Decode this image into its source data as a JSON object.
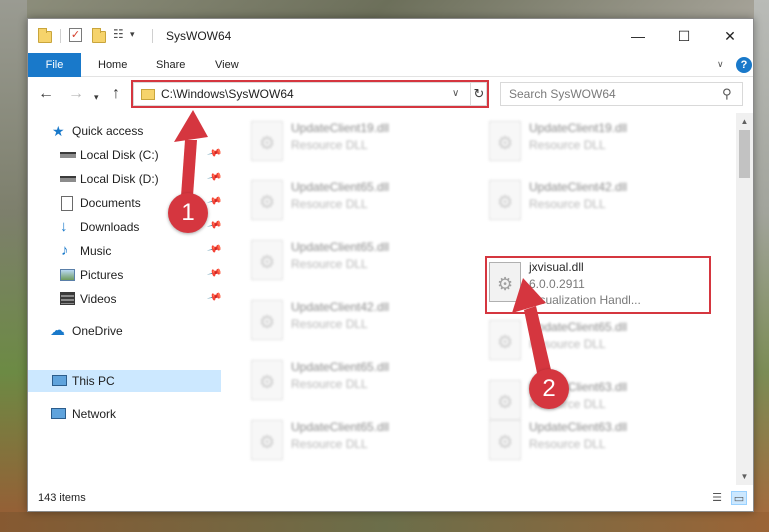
{
  "window": {
    "title": "SysWOW64",
    "minimize_glyph": "—",
    "maximize_glyph": "☐",
    "close_glyph": "✕"
  },
  "ribbon": {
    "tabs": [
      {
        "label": "File",
        "active": true
      },
      {
        "label": "Home"
      },
      {
        "label": "Share"
      },
      {
        "label": "View"
      }
    ],
    "help_glyph": "?",
    "accent_color": "#1979ca"
  },
  "address": {
    "path": "C:\\Windows\\SysWOW64",
    "search_placeholder": "Search SysWOW64"
  },
  "nav": {
    "items": [
      {
        "label": "Quick access",
        "icon": "star-icon",
        "pinned": false
      },
      {
        "label": "Local Disk (C:)",
        "icon": "drive-icon",
        "pinned": true
      },
      {
        "label": "Local Disk (D:)",
        "icon": "drive-icon",
        "pinned": true
      },
      {
        "label": "Documents",
        "icon": "documents-icon",
        "pinned": true
      },
      {
        "label": "Downloads",
        "icon": "downloads-icon",
        "pinned": true
      },
      {
        "label": "Music",
        "icon": "music-icon",
        "pinned": true
      },
      {
        "label": "Pictures",
        "icon": "pictures-icon",
        "pinned": true
      },
      {
        "label": "Videos",
        "icon": "videos-icon",
        "pinned": true
      },
      {
        "label": "OneDrive",
        "icon": "onedrive-icon",
        "pinned": false
      },
      {
        "label": "This PC",
        "icon": "computer-icon",
        "pinned": false,
        "selected": true
      },
      {
        "label": "Network",
        "icon": "network-icon",
        "pinned": false
      }
    ]
  },
  "files": {
    "left_column": [
      {
        "name": "UpdateClient19.dll",
        "desc": "Resource DLL"
      },
      {
        "name": "UpdateClient65.dll",
        "desc": "Resource DLL"
      },
      {
        "name": "UpdateClient65.dll",
        "desc": "Resource DLL"
      },
      {
        "name": "UpdateClient42.dll",
        "desc": "Resource DLL"
      },
      {
        "name": "UpdateClient65.dll",
        "desc": "Resource DLL"
      },
      {
        "name": "UpdateClient65.dll",
        "desc": "Resource DLL"
      }
    ],
    "right_column": [
      {
        "name": "UpdateClient19.dll",
        "desc": "Resource DLL"
      },
      {
        "name": "UpdateClient42.dll",
        "desc": "Resource DLL"
      },
      {
        "name": "jxvisual.dll",
        "desc": "6.0.0.2911",
        "desc2": "Visualization Handl...",
        "highlighted": true
      },
      {
        "name": "UpdateClient65.dll",
        "desc": "Resource DLL"
      },
      {
        "name": "UpdateClient63.dll",
        "desc": "Resource DLL"
      },
      {
        "name": "UpdateClient63.dll",
        "desc": "Resource DLL"
      }
    ]
  },
  "status": {
    "item_count": "143 items"
  },
  "annotations": {
    "step1": "1",
    "step2": "2",
    "color": "#d5363f"
  }
}
